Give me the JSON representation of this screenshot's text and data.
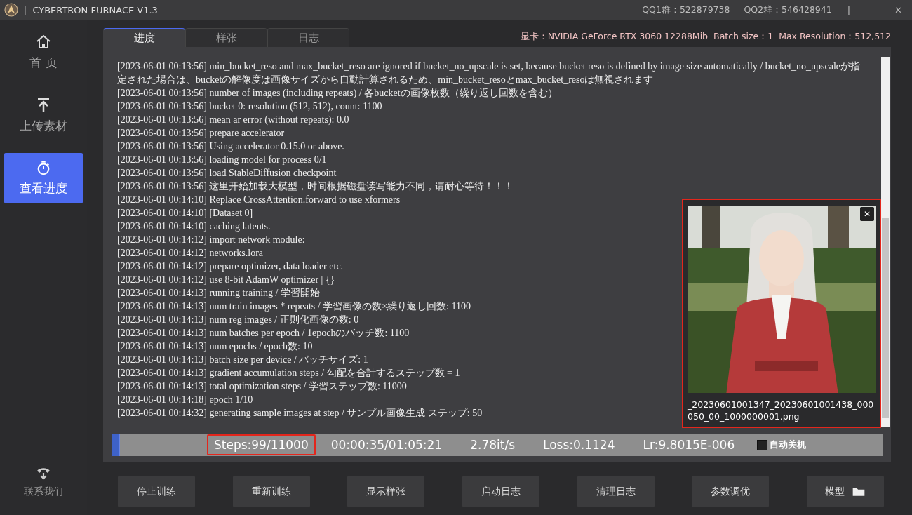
{
  "window": {
    "title": "CYBERTRON FURNACE V1.3",
    "separator": "|",
    "qq_groups": [
      "QQ1群：522879738",
      "QQ2群：546428941"
    ],
    "controls_separator": "|",
    "minimize": "—",
    "close": "✕"
  },
  "sidebar": {
    "items": [
      {
        "label": "首 页",
        "selected": false
      },
      {
        "label": "上传素材",
        "selected": false
      },
      {
        "label": "查看进度",
        "selected": true
      }
    ],
    "footer": {
      "label": "联系我们",
      "selected": false
    }
  },
  "tabs": [
    {
      "label": "进度",
      "selected": true
    },
    {
      "label": "样张",
      "selected": false
    },
    {
      "label": "日志",
      "selected": false
    }
  ],
  "gpu_info": [
    "显卡：NVIDIA GeForce RTX 3060 12288Mib",
    "Batch size：1",
    "Max Resolution：512,512"
  ],
  "log": [
    "[2023-06-01 00:13:56] min_bucket_reso and max_bucket_reso are ignored if bucket_no_upscale is set, because bucket reso is defined by image size automatically / bucket_no_upscaleが指定された場合は、bucketの解像度は画像サイズから自動計算されるため、min_bucket_resoとmax_bucket_resoは無視されます",
    "[2023-06-01 00:13:56] number of images (including repeats) / 各bucketの画像枚数（繰り返し回数を含む）",
    "[2023-06-01 00:13:56] bucket 0: resolution (512, 512), count: 1100",
    "[2023-06-01 00:13:56] mean ar error (without repeats): 0.0",
    "[2023-06-01 00:13:56] prepare accelerator",
    "[2023-06-01 00:13:56] Using accelerator 0.15.0 or above.",
    "[2023-06-01 00:13:56] loading model for process 0/1",
    "[2023-06-01 00:13:56] load StableDiffusion checkpoint",
    "[2023-06-01 00:13:56] 这里开始加载大模型，时间根据磁盘读写能力不同，请耐心等待！！！",
    "[2023-06-01 00:14:10] Replace CrossAttention.forward to use xformers",
    "[2023-06-01 00:14:10] [Dataset 0]",
    "[2023-06-01 00:14:10] caching latents.",
    "[2023-06-01 00:14:12] import network module:",
    "[2023-06-01 00:14:12] networks.lora",
    "[2023-06-01 00:14:12] prepare optimizer, data loader etc.",
    "[2023-06-01 00:14:12] use 8-bit AdamW optimizer | {}",
    "[2023-06-01 00:14:13] running training / 学習開始",
    "[2023-06-01 00:14:13] num train images * repeats / 学習画像の数×繰り返し回数: 1100",
    "[2023-06-01 00:14:13] num reg images / 正則化画像の数: 0",
    "[2023-06-01 00:14:13] num batches per epoch / 1epochのバッチ数: 1100",
    "[2023-06-01 00:14:13] num epochs / epoch数: 10",
    "[2023-06-01 00:14:13] batch size per device / バッチサイズ: 1",
    "[2023-06-01 00:14:13] gradient accumulation steps / 勾配を合計するステップ数 = 1",
    "[2023-06-01 00:14:13] total optimization steps / 学習ステップ数: 11000",
    "[2023-06-01 00:14:18] epoch 1/10",
    "[2023-06-01 00:14:32] generating sample images at step / サンプル画像生成 ステップ: 50"
  ],
  "sample_popup": {
    "kind": "picture",
    "close": "✕",
    "filename": "_20230601001347_20230601001438_000050_00_1000000001.png"
  },
  "progress": {
    "level": 0.009,
    "steps": "Steps:99/11000",
    "time": "00:00:35/01:05:21",
    "speed": "2.78it/s",
    "loss": "Loss:0.1124",
    "lr": "Lr:9.8015E-006",
    "auto_shutdown": {
      "label": "自动关机",
      "checked": false
    }
  },
  "buttons": [
    {
      "label": "停止训练"
    },
    {
      "label": "重新训练"
    },
    {
      "label": "显示样张"
    },
    {
      "label": "启动日志"
    },
    {
      "label": "清理日志"
    },
    {
      "label": "参数调优"
    },
    {
      "label": "模型"
    }
  ]
}
